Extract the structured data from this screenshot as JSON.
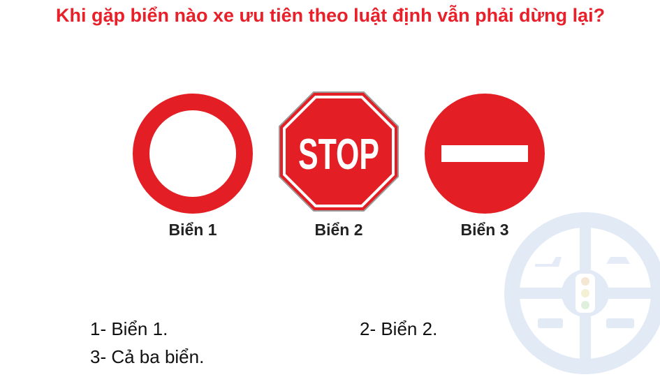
{
  "question": {
    "text": "Khi gặp biển nào xe ưu tiên theo luật định vẫn phải dừng lại?"
  },
  "signs": [
    {
      "label": "Biển 1",
      "icon": "no-vehicles-sign-icon"
    },
    {
      "label": "Biển 2",
      "icon": "stop-sign-icon",
      "text": "STOP"
    },
    {
      "label": "Biển 3",
      "icon": "no-entry-sign-icon"
    }
  ],
  "answers": [
    {
      "text": "1- Biển 1."
    },
    {
      "text": "2- Biển 2."
    },
    {
      "text": "3- Cả ba biển."
    }
  ],
  "colors": {
    "question": "#e8202a",
    "sign_red": "#e31e24",
    "watermark": "#e2eaf6"
  }
}
